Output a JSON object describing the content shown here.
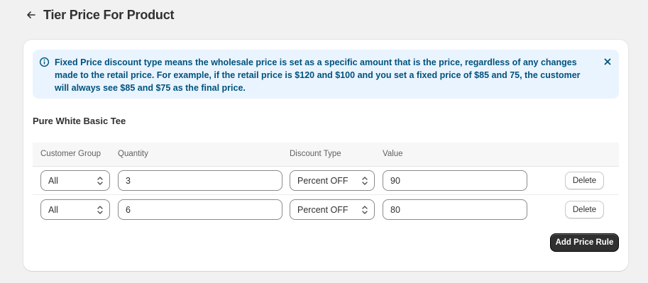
{
  "header": {
    "title": "Tier Price For Product",
    "back_icon": "arrow-left-icon"
  },
  "banner": {
    "icon": "info-icon",
    "text": "Fixed Price discount type means the wholesale price is set as a specific amount that is the price, regardless of any changes made to the retail price. For example, if the retail price is $120 and $100 and you set a fixed price of $85 and 75, the customer will always see $85 and $75 as the final price.",
    "close_icon": "close-icon",
    "background": "#eaf4ff",
    "text_color": "#00527c"
  },
  "product": {
    "name": "Pure White Basic Tee"
  },
  "table": {
    "columns": {
      "customer_group": "Customer Group",
      "quantity": "Quantity",
      "discount_type": "Discount Type",
      "value": "Value"
    },
    "rows": [
      {
        "customer_group": "All",
        "quantity": "3",
        "discount_type": "Percent OFF",
        "value": "90",
        "delete_label": "Delete"
      },
      {
        "customer_group": "All",
        "quantity": "6",
        "discount_type": "Percent OFF",
        "value": "80",
        "delete_label": "Delete"
      }
    ]
  },
  "actions": {
    "add_label": "Add Price Rule"
  }
}
